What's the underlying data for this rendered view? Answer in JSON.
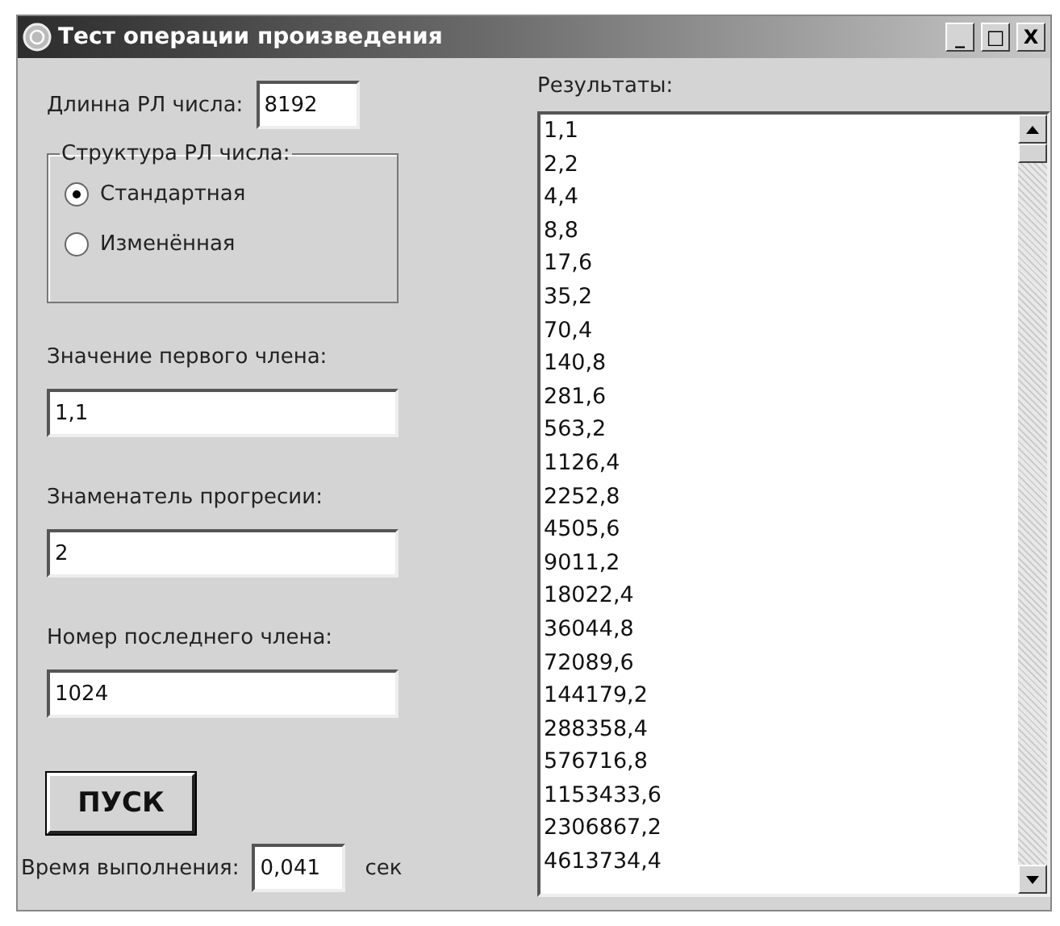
{
  "window": {
    "title": "Тест операции произведения",
    "controls": [
      "_",
      "□",
      "X"
    ]
  },
  "length": {
    "label": "Длинна РЛ числа:",
    "value": "8192"
  },
  "structure": {
    "legend": "Структура РЛ числа:",
    "options": [
      {
        "label": "Стандартная",
        "selected": true
      },
      {
        "label": "Изменённая",
        "selected": false
      }
    ]
  },
  "fields": [
    {
      "label": "Значение первого члена:",
      "value": "1,1"
    },
    {
      "label": "Знаменатель прогреcии:",
      "value": "2"
    },
    {
      "label": "Номер последнего члена:",
      "value": "1024"
    }
  ],
  "start_button": "ПУСК",
  "time": {
    "label": "Время выполнения:",
    "value": "0,041",
    "unit": "сек"
  },
  "results": {
    "label": "Результаты:",
    "items": [
      "1,1",
      "2,2",
      "4,4",
      "8,8",
      "17,6",
      "35,2",
      "70,4",
      "140,8",
      "281,6",
      "563,2",
      "1126,4",
      "2252,8",
      "4505,6",
      "9011,2",
      "18022,4",
      "36044,8",
      "72089,6",
      "144179,2",
      "288358,4",
      "576716,8",
      "1153433,6",
      "2306867,2",
      "4613734,4"
    ]
  }
}
